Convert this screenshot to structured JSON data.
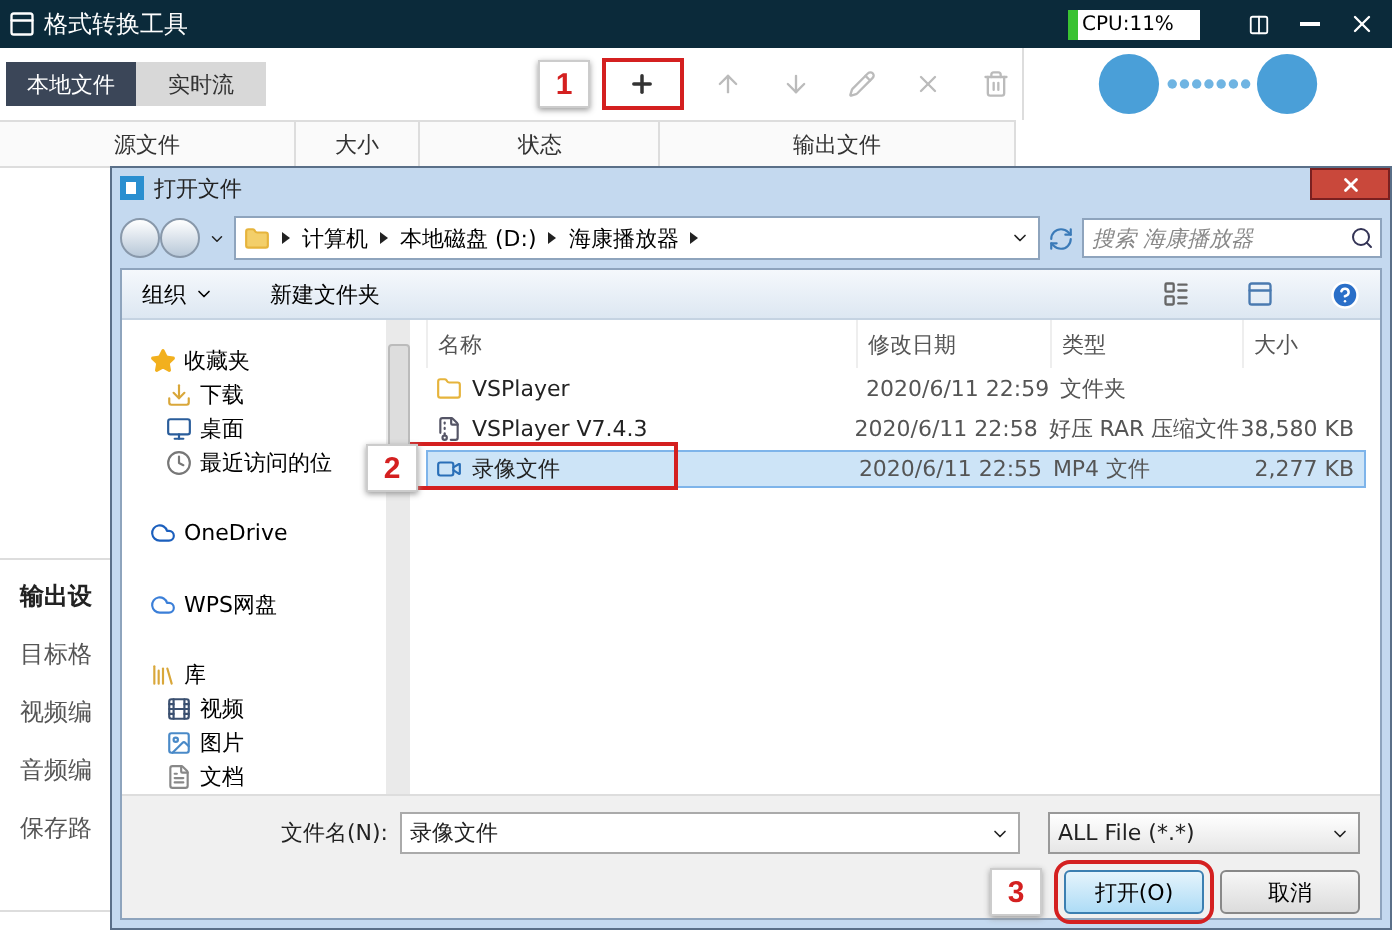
{
  "app": {
    "title": "格式转换工具",
    "cpu": {
      "label": "CPU:11%",
      "level": 0.11
    },
    "tabs": [
      {
        "label": "本地文件",
        "selected": true
      },
      {
        "label": "实时流",
        "selected": false
      }
    ],
    "toolbar": [
      {
        "kind": "add",
        "step": "1",
        "disabled": false
      },
      {
        "kind": "up",
        "disabled": true
      },
      {
        "kind": "down",
        "disabled": true
      },
      {
        "kind": "edit",
        "disabled": true
      },
      {
        "kind": "remove",
        "disabled": true
      },
      {
        "kind": "trash",
        "disabled": true
      }
    ],
    "columns": [
      "源文件",
      "大小",
      "状态",
      "输出文件"
    ],
    "settings_title": "输出设",
    "settings": [
      "目标格",
      "视频编",
      "音频编",
      "保存路"
    ]
  },
  "dialog": {
    "title": "打开文件",
    "breadcrumb": [
      "计算机",
      "本地磁盘 (D:)",
      "海康播放器"
    ],
    "search": {
      "placeholder": "搜索 海康播放器"
    },
    "organize": "组织",
    "new_folder": "新建文件夹",
    "nav": [
      {
        "label": "收藏夹",
        "kind": "star",
        "children": [
          {
            "label": "下载",
            "kind": "download"
          },
          {
            "label": "桌面",
            "kind": "desktop"
          },
          {
            "label": "最近访问的位",
            "kind": "recent"
          }
        ]
      },
      {
        "label": "OneDrive",
        "kind": "onedrive"
      },
      {
        "label": "WPS网盘",
        "kind": "cloud"
      },
      {
        "label": "库",
        "kind": "library",
        "children": [
          {
            "label": "视频",
            "kind": "video"
          },
          {
            "label": "图片",
            "kind": "picture"
          },
          {
            "label": "文档",
            "kind": "document"
          }
        ]
      }
    ],
    "columns": [
      "名称",
      "修改日期",
      "类型",
      "大小"
    ],
    "files": [
      {
        "name": "VSPlayer",
        "date": "2020/6/11 22:59",
        "type": "文件夹",
        "kind": "folder",
        "selected": false
      },
      {
        "name": "VSPlayer V7.4.3",
        "date": "2020/6/11 22:58",
        "type": "好压 RAR 压缩文件",
        "size": "38,580 KB",
        "kind": "archive",
        "selected": false
      },
      {
        "name": "录像文件",
        "date": "2020/6/11 22:55",
        "type": "MP4 文件",
        "size": "2,277 KB",
        "kind": "video",
        "selected": true,
        "step": "2"
      }
    ],
    "filename_label": "文件名(N):",
    "filename": "录像文件",
    "filetype": "ALL File (*.*)",
    "buttons": [
      {
        "label": "打开(O)",
        "kind": "primary",
        "step": "3"
      },
      {
        "label": "取消",
        "kind": "normal"
      }
    ]
  }
}
